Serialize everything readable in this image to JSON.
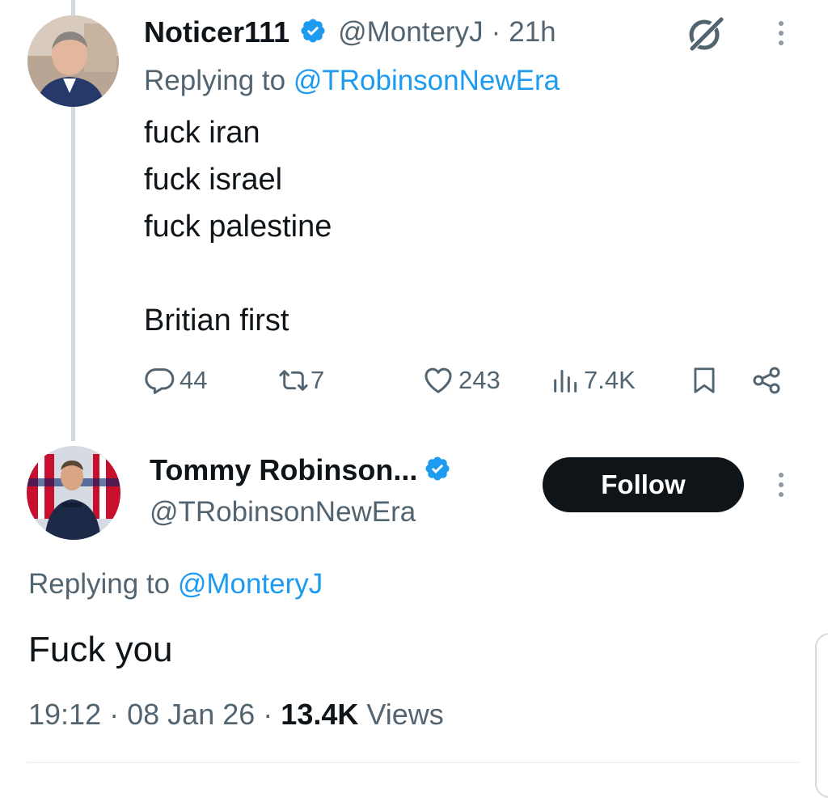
{
  "tweet1": {
    "author_name": "Noticer111",
    "handle": "@MonteryJ",
    "dot": "·",
    "time": "21h",
    "reply_prefix": "Replying to ",
    "reply_handle": "@TRobinsonNewEra",
    "lines": [
      "fuck iran",
      "fuck israel",
      "fuck palestine",
      "",
      "Britian first"
    ],
    "replies": "44",
    "reposts": "7",
    "likes": "243",
    "views": "7.4K"
  },
  "tweet2": {
    "author_name": "Tommy Robinson...",
    "handle": "@TRobinsonNewEra",
    "follow_label": "Follow",
    "reply_prefix": "Replying to ",
    "reply_handle": "@MonteryJ",
    "text": "Fuck you",
    "time": "19:12",
    "date": "08 Jan 26",
    "dot": "·",
    "views_count": "13.4K",
    "views_label": "Views"
  },
  "icons": {
    "verified": "verified-badge-icon",
    "grok": "grok-icon",
    "more": "more-dots-icon",
    "reply": "reply-icon",
    "repost": "repost-icon",
    "like": "heart-icon",
    "views": "views-icon",
    "bookmark": "bookmark-icon",
    "share": "share-icon"
  },
  "colors": {
    "accent": "#1d9bf0",
    "text": "#0f1419",
    "secondary": "#536471",
    "button": "#0f1419"
  }
}
